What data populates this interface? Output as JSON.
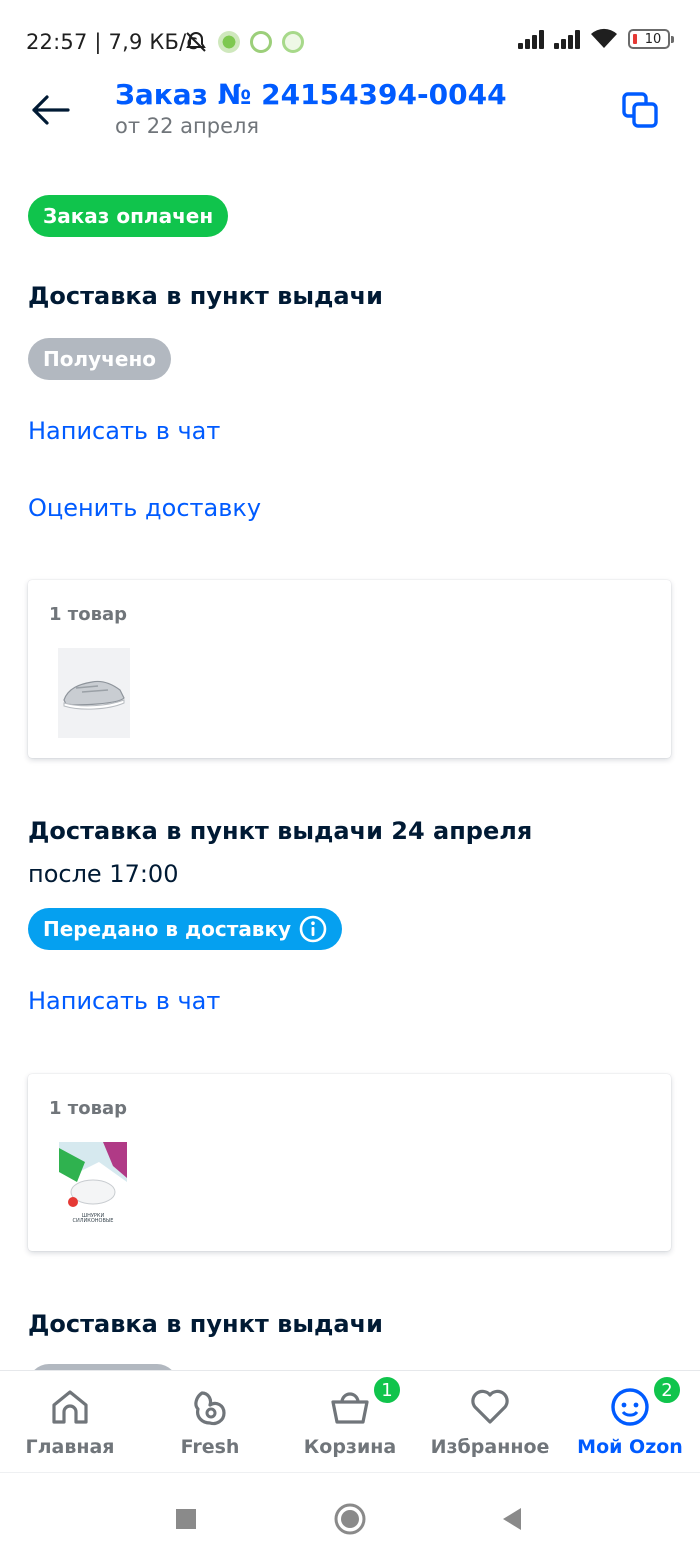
{
  "status_bar": {
    "time": "22:57 | 7,9 КБ/с",
    "battery": "10"
  },
  "header": {
    "title": "Заказ № 24154394-0044",
    "subtitle": "от 22 апреля"
  },
  "order_status": "Заказ оплачен",
  "shipments": [
    {
      "title": "Доставка в пункт выдачи",
      "status": "Получено",
      "links": [
        "Написать в чат",
        "Оценить доставку"
      ],
      "items_count": "1 товар",
      "item_image": "silver-sneaker-icon"
    },
    {
      "title": "Доставка в пункт выдачи 24 апреля",
      "subtitle": "после 17:00",
      "status": "Передано в доставку",
      "links": [
        "Написать в чат"
      ],
      "items_count": "1 товар",
      "item_image": "silicone-laces-package-icon",
      "item_image_caption": "ШНУРКИ СИЛИКОНОВЫЕ"
    },
    {
      "title": "Доставка в пункт выдачи"
    }
  ],
  "bottom_nav": [
    {
      "label": "Главная",
      "icon": "home-icon"
    },
    {
      "label": "Fresh",
      "icon": "fresh-icon"
    },
    {
      "label": "Корзина",
      "icon": "basket-icon",
      "badge": "1"
    },
    {
      "label": "Избранное",
      "icon": "heart-icon"
    },
    {
      "label": "Мой Ozon",
      "icon": "profile-smile-icon",
      "badge": "2",
      "active": true
    }
  ],
  "colors": {
    "accent": "#005bff",
    "green": "#10c44c",
    "gray_badge": "#b2b8c0",
    "blue_badge": "#05a0f0",
    "text": "#001a34",
    "muted": "#70757a"
  }
}
